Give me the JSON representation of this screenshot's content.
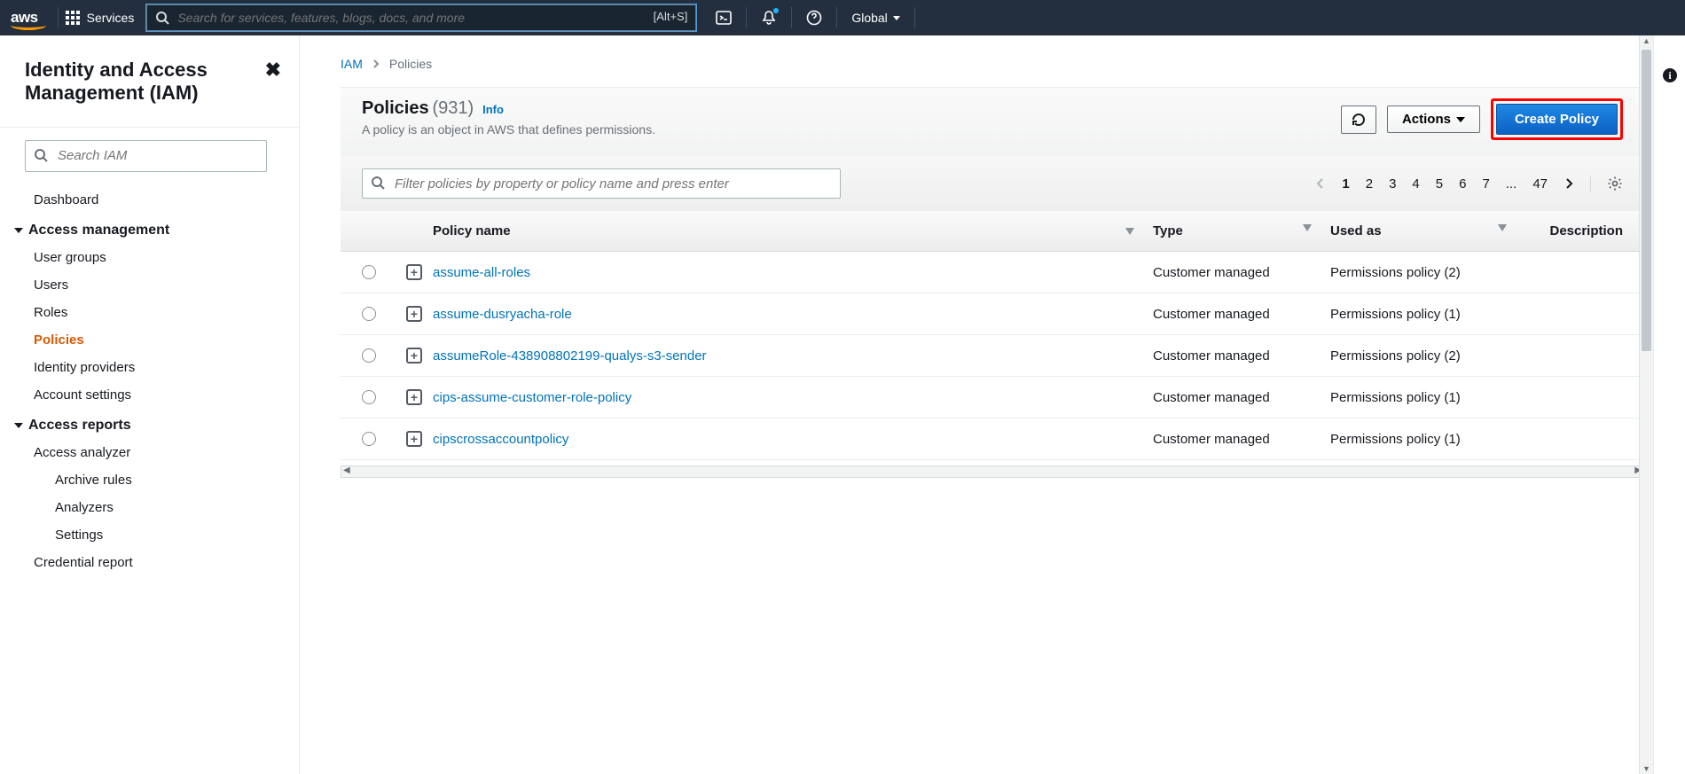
{
  "topnav": {
    "logo": "aws",
    "services": "Services",
    "search_placeholder": "Search for services, features, blogs, docs, and more",
    "search_shortcut": "[Alt+S]",
    "region": "Global"
  },
  "sidebar": {
    "title": "Identity and Access Management (IAM)",
    "search_placeholder": "Search IAM",
    "dashboard": "Dashboard",
    "group_access": "Access management",
    "items_access": {
      "user_groups": "User groups",
      "users": "Users",
      "roles": "Roles",
      "policies": "Policies",
      "identity_providers": "Identity providers",
      "account_settings": "Account settings"
    },
    "group_reports": "Access reports",
    "items_reports": {
      "access_analyzer": "Access analyzer",
      "archive_rules": "Archive rules",
      "analyzers": "Analyzers",
      "settings": "Settings",
      "credential_report": "Credential report"
    }
  },
  "breadcrumb": {
    "root": "IAM",
    "current": "Policies"
  },
  "header": {
    "title": "Policies",
    "count": "(931)",
    "info": "Info",
    "desc": "A policy is an object in AWS that defines permissions.",
    "actions": "Actions",
    "create": "Create Policy"
  },
  "filter": {
    "placeholder": "Filter policies by property or policy name and press enter"
  },
  "pager": {
    "p1": "1",
    "p2": "2",
    "p3": "3",
    "p4": "4",
    "p5": "5",
    "p6": "6",
    "p7": "7",
    "dots": "...",
    "last": "47"
  },
  "table": {
    "h_name": "Policy name",
    "h_type": "Type",
    "h_used": "Used as",
    "h_desc": "Description",
    "rows": [
      {
        "name": "assume-all-roles",
        "type": "Customer managed",
        "used": "Permissions policy (2)"
      },
      {
        "name": "assume-dusryacha-role",
        "type": "Customer managed",
        "used": "Permissions policy (1)"
      },
      {
        "name": "assumeRole-438908802199-qualys-s3-sender",
        "type": "Customer managed",
        "used": "Permissions policy (2)"
      },
      {
        "name": "cips-assume-customer-role-policy",
        "type": "Customer managed",
        "used": "Permissions policy (1)"
      },
      {
        "name": "cipscrossaccountpolicy",
        "type": "Customer managed",
        "used": "Permissions policy (1)"
      }
    ]
  }
}
